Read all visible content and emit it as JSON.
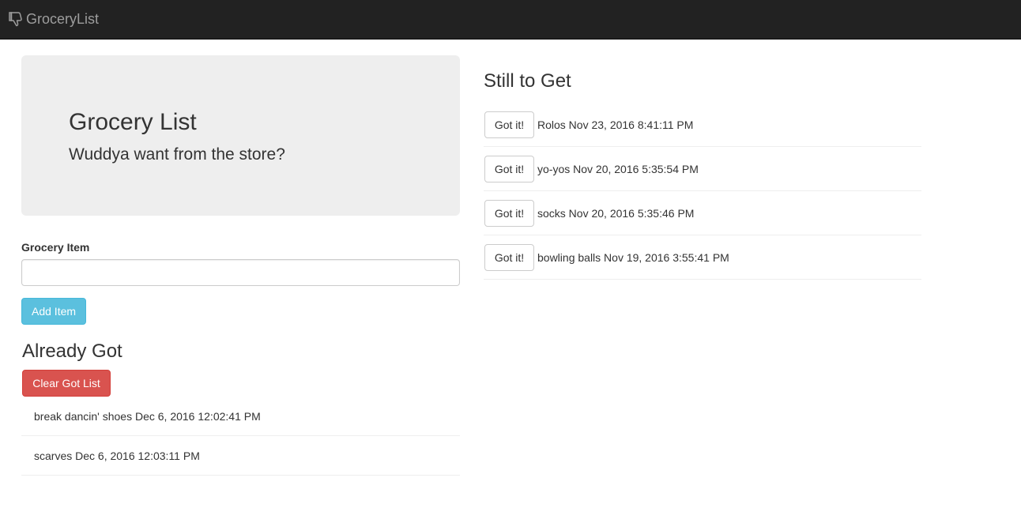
{
  "navbar": {
    "brand": "GroceryList",
    "brand_icon": "thumbs-down-icon"
  },
  "jumbotron": {
    "title": "Grocery List",
    "subtitle": "Wuddya want from the store?"
  },
  "form": {
    "label": "Grocery Item",
    "input_value": "",
    "input_placeholder": "",
    "add_button": "Add Item"
  },
  "already_got": {
    "title": "Already Got",
    "clear_button": "Clear Got List",
    "items": [
      {
        "text": "break dancin' shoes Dec 6, 2016 12:02:41 PM"
      },
      {
        "text": "scarves Dec 6, 2016 12:03:11 PM"
      }
    ]
  },
  "still_to_get": {
    "title": "Still to Get",
    "items": [
      {
        "button": "Got it!",
        "text": "Rolos Nov 23, 2016 8:41:11 PM"
      },
      {
        "button": "Got it!",
        "text": "yo-yos Nov 20, 2016 5:35:54 PM"
      },
      {
        "button": "Got it!",
        "text": "socks Nov 20, 2016 5:35:46 PM"
      },
      {
        "button": "Got it!",
        "text": "bowling balls Nov 19, 2016 3:55:41 PM"
      }
    ]
  },
  "colors": {
    "navbar_bg": "#222222",
    "brand_text": "#9d9d9d",
    "jumbotron_bg": "#eeeeee",
    "info_button": "#5bc0de",
    "danger_button": "#d9534f"
  }
}
